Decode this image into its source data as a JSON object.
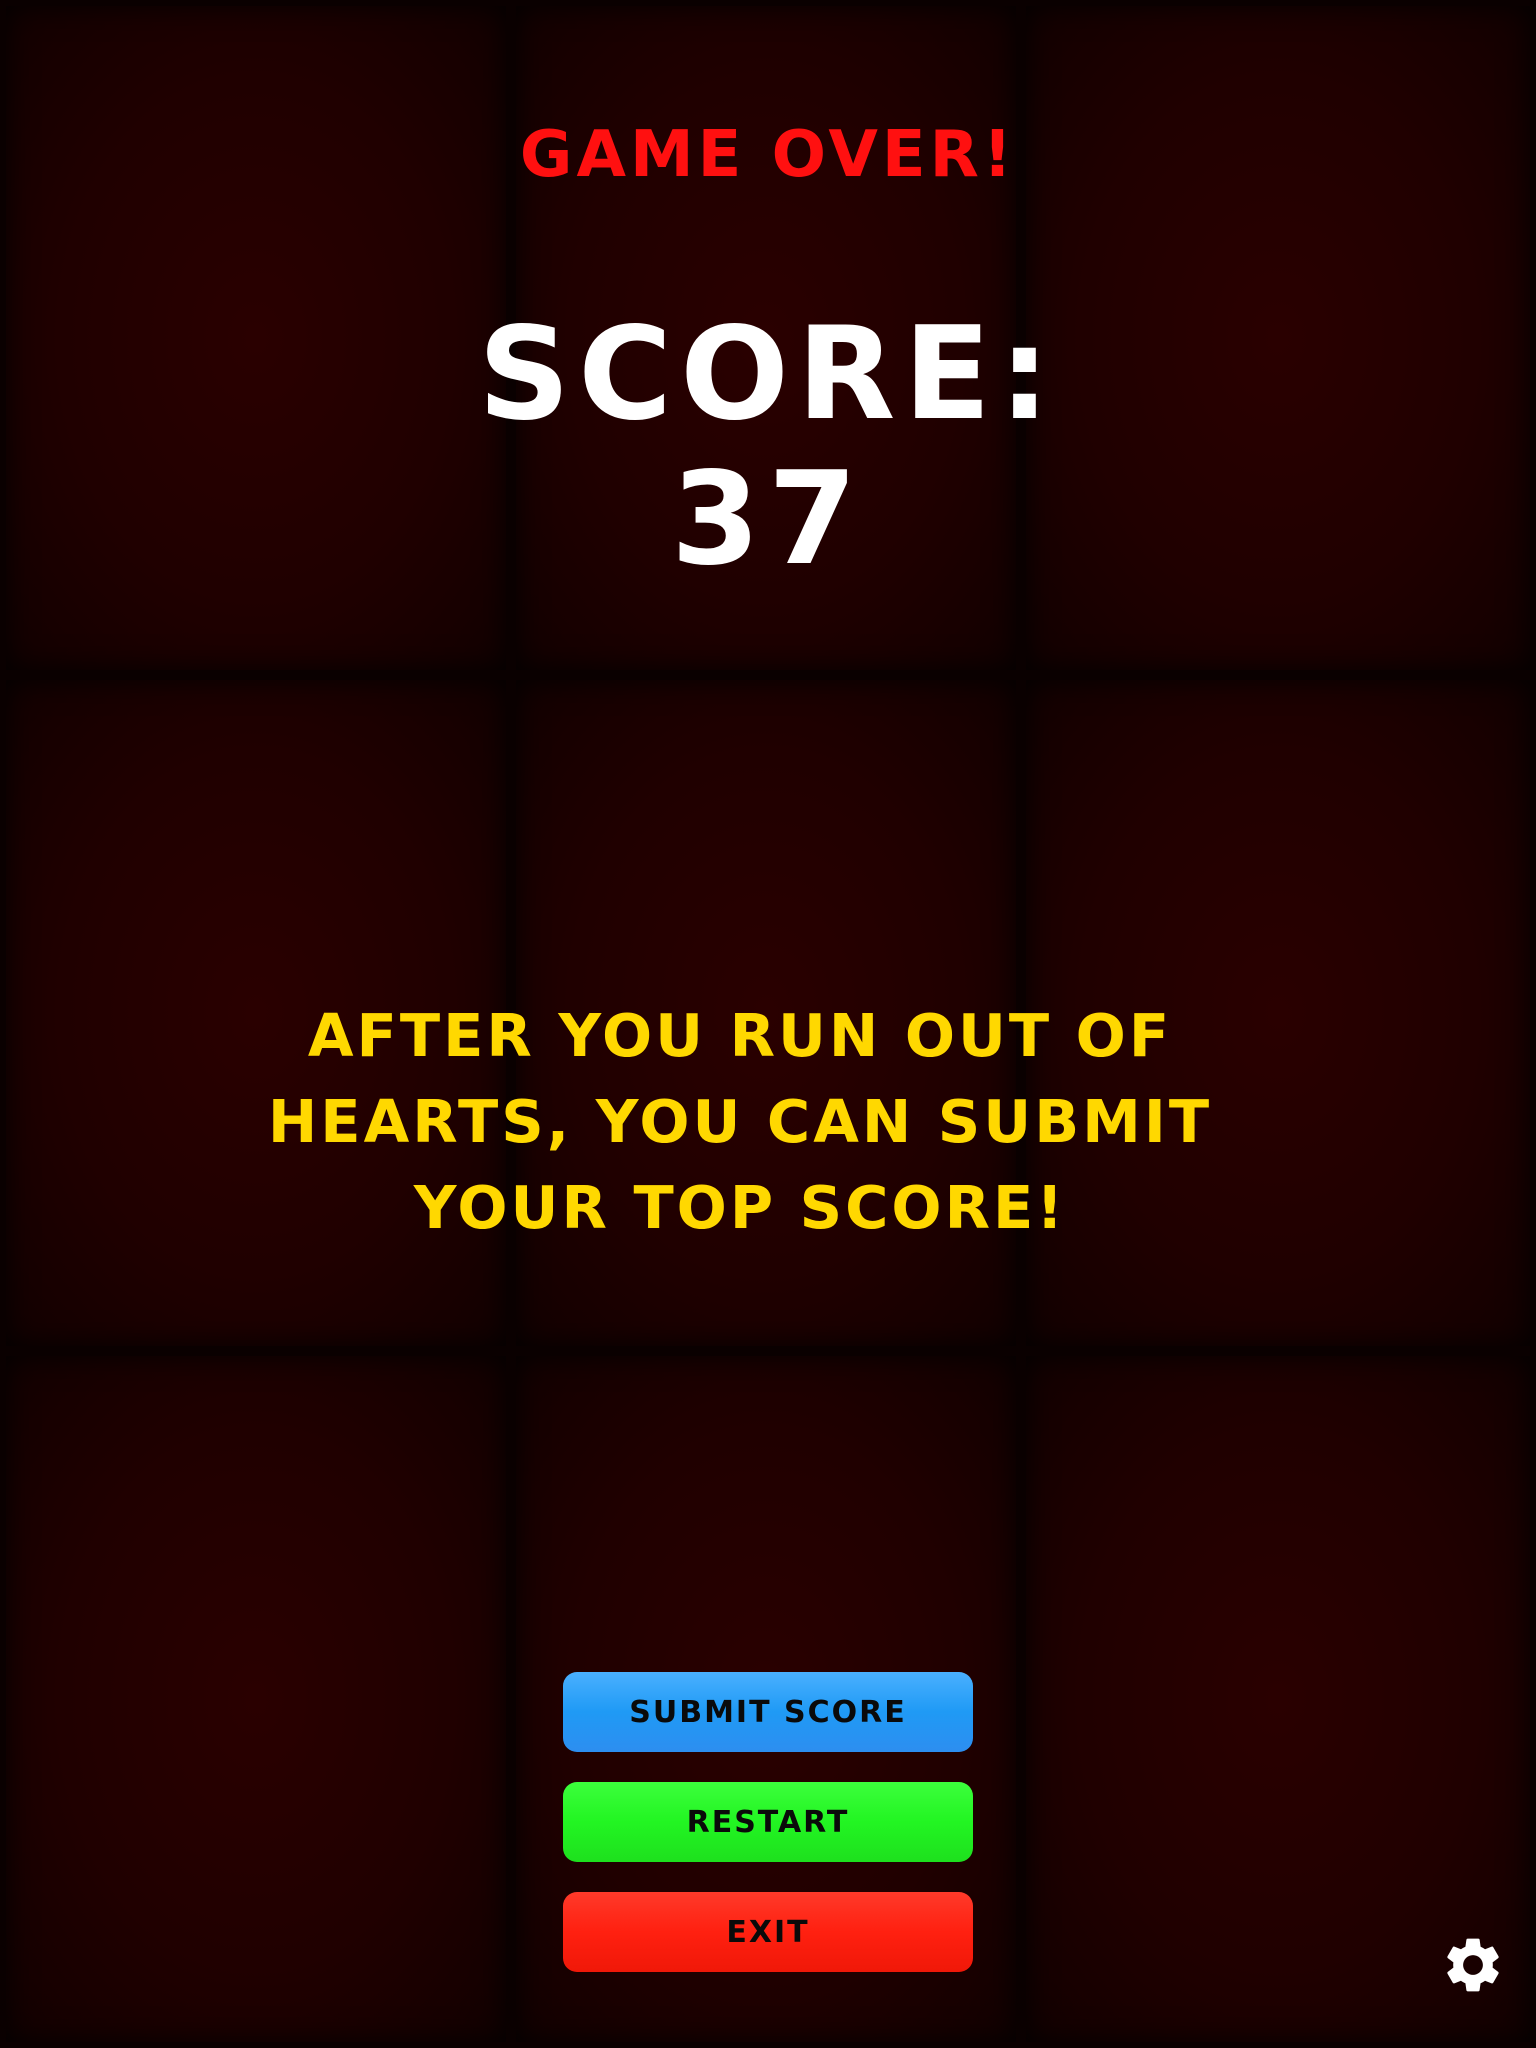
{
  "heading": {
    "game_over": "GAME OVER!",
    "score_label": "SCORE:",
    "score_value": "37"
  },
  "info": {
    "message": "AFTER YOU RUN OUT OF HEARTS, YOU CAN SUBMIT YOUR TOP SCORE!"
  },
  "buttons": {
    "submit_label": "SUBMIT SCORE",
    "restart_label": "RESTART",
    "exit_label": "EXIT"
  },
  "icons": {
    "settings": "gear-icon"
  },
  "colors": {
    "game_over": "#ff1010",
    "score": "#ffffff",
    "info": "#ffd800",
    "submit": "#2d9cf5",
    "restart": "#22f522",
    "exit": "#ff2010",
    "tile": "#200000"
  }
}
